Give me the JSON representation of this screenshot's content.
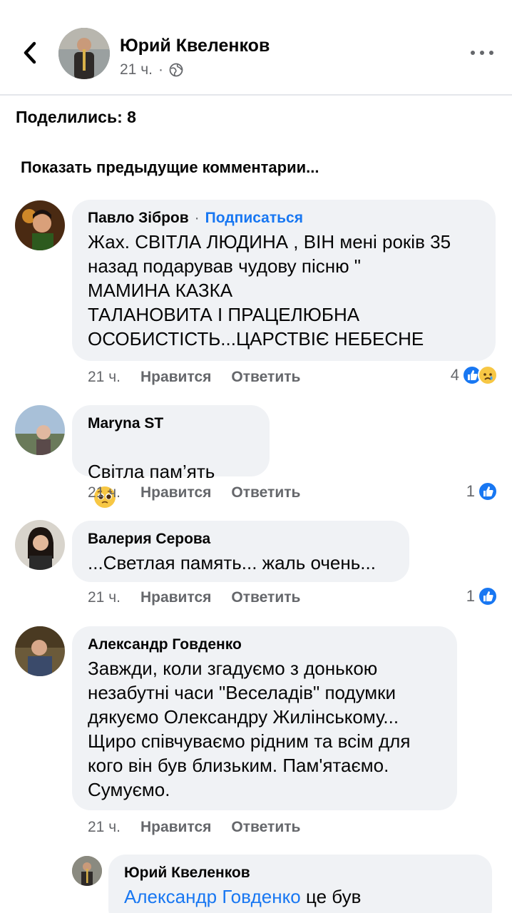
{
  "post": {
    "author": "Юрий Квеленков",
    "time": "21 ч.",
    "separator": "·",
    "shares": "Поделились: 8",
    "show_previous": "Показать предыдущие комментарии..."
  },
  "icons": {
    "back": "chevron-left-icon",
    "more": "more-dots-icon",
    "privacy": "globe-icon",
    "like": "like-reaction-icon",
    "sad": "sad-reaction-icon",
    "pleading": "pleading-face-emoji"
  },
  "colors": {
    "accent": "#1877f2",
    "bubble": "#f0f2f5",
    "meta": "#65676b"
  },
  "comments": [
    {
      "author": "Павло Зібров",
      "dot": "·",
      "follow": "Подписаться",
      "text": "Жах. СВІТЛА ЛЮДИНА , ВІН мені років 35\nназад подарував чудову пісню \"\nМАМИНА КАЗКА\nТАЛАНОВИТА І ПРАЦЕЛЮБНА\nОСОБИСТІСТЬ...ЦАРСТВІЄ НЕБЕСНЕ",
      "time": "21 ч.",
      "like": "Нравится",
      "reply": "Ответить",
      "reactions": "4"
    },
    {
      "author": "Maryna ST",
      "text": "Світла пам’ять",
      "time": "21 ч.",
      "like": "Нравится",
      "reply": "Ответить",
      "reactions": "1"
    },
    {
      "author": "Валерия Серова",
      "text": "...Светлая память... жаль очень...",
      "time": "21 ч.",
      "like": "Нравится",
      "reply": "Ответить",
      "reactions": "1"
    },
    {
      "author": "Александр Говденко",
      "text": "Завжди, коли згадуємо з донькою\nнезабутні часи \"Веселадів\"  подумки\nдякуємо Олександру Жилінському...\nЩиро співчуваємо рідним та всім для\nкого він був близьким. Пам'ятаємо.\nСумуємо.",
      "time": "21 ч.",
      "like": "Нравится",
      "reply": "Ответить"
    }
  ],
  "reply": {
    "author": "Юрий Квеленков",
    "mention": "Александр Говденко",
    "text": " це був"
  }
}
